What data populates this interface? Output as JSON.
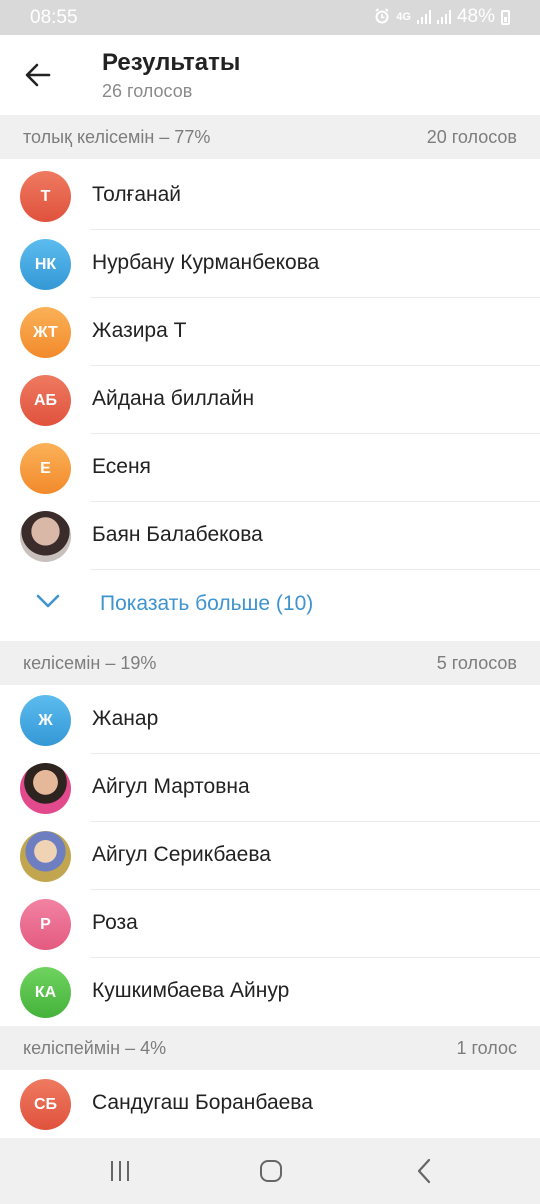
{
  "status_bar": {
    "time": "08:55",
    "network": "4G",
    "battery": "48%"
  },
  "header": {
    "title": "Результаты",
    "subtitle": "26 голосов"
  },
  "sections": [
    {
      "label": "толық келісемін – 77%",
      "count": "20 голосов",
      "voters": [
        {
          "name": "Толғанай",
          "initials": "Т",
          "color": "#e5604a"
        },
        {
          "name": "Нурбану Курманбекова",
          "initials": "НК",
          "color": "#3fa6de"
        },
        {
          "name": "Жазира Т",
          "initials": "ЖТ",
          "color": "#f59a3b"
        },
        {
          "name": "Айдана биллайн",
          "initials": "АБ",
          "color": "#e5604a"
        },
        {
          "name": "Есеня",
          "initials": "Е",
          "color": "#f59a3b"
        },
        {
          "name": "Баян Балабекова",
          "initials": "",
          "color": "#9c8a86"
        }
      ],
      "show_more": "Показать больше (10)"
    },
    {
      "label": "келісемін – 19%",
      "count": "5 голосов",
      "voters": [
        {
          "name": "Жанар",
          "initials": "Ж",
          "color": "#3fa6de"
        },
        {
          "name": "Айгул Мартовна",
          "initials": "",
          "color": "#c9808c"
        },
        {
          "name": "Айгул Серикбаева",
          "initials": "",
          "color": "#8f9a55"
        },
        {
          "name": "Роза",
          "initials": "Р",
          "color": "#ec6d8e"
        },
        {
          "name": "Кушкимбаева Айнур",
          "initials": "КА",
          "color": "#55c04a"
        }
      ]
    },
    {
      "label": "келіспеймін – 4%",
      "count": "1 голос",
      "voters": [
        {
          "name": "Сандугаш Боранбаева",
          "initials": "СБ",
          "color": "#e5604a"
        }
      ]
    }
  ],
  "icons": {
    "back": "arrow-left-icon",
    "show_more": "chevron-down-icon",
    "nav_recents": "recents-icon",
    "nav_home": "home-icon",
    "nav_back": "back-icon"
  }
}
